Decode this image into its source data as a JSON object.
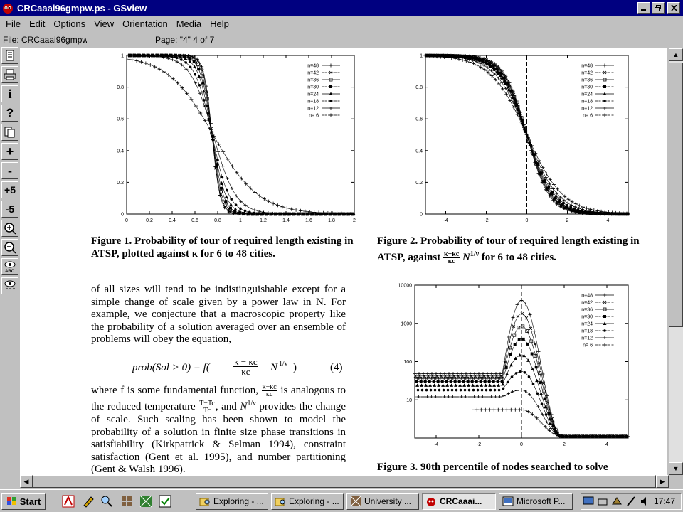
{
  "window": {
    "title": "CRCaaai96gmpw.ps - GSview"
  },
  "menu": [
    "File",
    "Edit",
    "Options",
    "View",
    "Orientation",
    "Media",
    "Help"
  ],
  "infobar": {
    "file": "File: CRCaaai96gmpw.ps",
    "page": "Page: \"4\"  4 of 7"
  },
  "toolbar": {
    "tools": [
      "open-icon",
      "print-icon",
      "info-icon",
      "help-icon",
      "goto-icon",
      "+",
      "-",
      "+5",
      "-5",
      "zoom-in-icon",
      "zoom-out-icon",
      "eye-abc-icon",
      "eye-icon"
    ]
  },
  "document": {
    "fig1_caption": "Figure 1.  Probability of tour of required length existing in ATSP, plotted against κ for 6 to 48 cities.",
    "fig2_caption_a": "Figure 2.  Probability of tour of required length existing in ATSP, against",
    "fig2_caption_b": "N",
    "fig2_caption_c": "for 6 to 48 cities.",
    "fig2_frac_num": "κ−κc",
    "fig2_frac_den": "κc",
    "fig2_exp": "1/ν",
    "fig3_caption": "Figure 3.  90th percentile of nodes searched to solve",
    "body_p1": "of all sizes will tend to be indistinguishable except for a simple change of scale given by a power law in N. For example, we conjecture that a macroscopic property like the probability of a solution averaged over an ensemble of problems will obey the equation,",
    "equation_lhs": "prob(Sol > 0) = f(",
    "equation_num": "κ − κc",
    "equation_den": "κc",
    "equation_rhs": "N",
    "equation_exp": "1/ν",
    "equation_close": ")",
    "equation_number": "(4)",
    "body_p2_a": "where f is some fundamental function,",
    "body_p2_frac_num": "κ−κc",
    "body_p2_frac_den": "κc",
    "body_p2_b": "is analogous to the reduced temperature",
    "body_p2_frac2_num": "T−Tc",
    "body_p2_frac2_den": "Tc",
    "body_p2_c": ", and",
    "body_p2_d": "N",
    "body_p2_exp": "1/ν",
    "body_p2_e": "provides the change of scale. Such scaling has been shown to model the probability of a solution in finite size phase transitions in satisfiability (Kirkpatrick & Selman 1994), constraint satisfaction (Gent et al. 1995), and number partitioning (Gent & Walsh 1996)."
  },
  "legend_labels": [
    "n=48",
    "n=42",
    "n=36",
    "n=30",
    "n=24",
    "n=18",
    "n=12",
    "n= 6"
  ],
  "chart_data": [
    {
      "type": "line",
      "title": "",
      "xlabel": "",
      "ylabel": "",
      "xlim": [
        0,
        2
      ],
      "ylim": [
        0,
        1
      ],
      "x_ticks": [
        "0",
        "0.2",
        "0.4",
        "0.6",
        "0.8",
        "1",
        "1.2",
        "1.4",
        "1.6",
        "1.8",
        "2"
      ],
      "y_ticks": [
        "0",
        "0.2",
        "0.4",
        "0.6",
        "0.8",
        "1"
      ],
      "legend_position": "top-right",
      "series": [
        {
          "name": "n=48",
          "kc": 0.75,
          "w": 0.035
        },
        {
          "name": "n=42",
          "kc": 0.75,
          "w": 0.038
        },
        {
          "name": "n=36",
          "kc": 0.75,
          "w": 0.043
        },
        {
          "name": "n=30",
          "kc": 0.75,
          "w": 0.05
        },
        {
          "name": "n=24",
          "kc": 0.75,
          "w": 0.06
        },
        {
          "name": "n=18",
          "kc": 0.75,
          "w": 0.075
        },
        {
          "name": "n=12",
          "kc": 0.76,
          "w": 0.1
        },
        {
          "name": "n= 6",
          "kc": 0.76,
          "w": 0.2
        }
      ]
    },
    {
      "type": "line",
      "title": "",
      "xlabel": "",
      "ylabel": "",
      "xlim": [
        -5,
        5
      ],
      "ylim": [
        0,
        1
      ],
      "x_ticks": [
        "-4",
        "-2",
        "0",
        "2",
        "4"
      ],
      "y_ticks": [
        "0",
        "0.2",
        "0.4",
        "0.6",
        "0.8",
        "1"
      ],
      "legend_position": "top-right",
      "series": [
        {
          "name": "n=48",
          "w": 0.55
        },
        {
          "name": "n=42",
          "w": 0.58
        },
        {
          "name": "n=36",
          "w": 0.6
        },
        {
          "name": "n=30",
          "w": 0.63
        },
        {
          "name": "n=24",
          "w": 0.66
        },
        {
          "name": "n=18",
          "w": 0.7
        },
        {
          "name": "n=12",
          "w": 0.78
        },
        {
          "name": "n= 6",
          "w": 0.9
        }
      ]
    },
    {
      "type": "line",
      "title": "",
      "xlabel": "",
      "ylabel": "",
      "xlim": [
        -5,
        5
      ],
      "ylim": [
        1,
        10000
      ],
      "y_scale": "log",
      "x_ticks": [
        "-4",
        "-2",
        "0",
        "2",
        "4"
      ],
      "y_ticks": [
        "10",
        "100",
        "1000",
        "10000"
      ],
      "legend_position": "top-right",
      "series": [
        {
          "name": "n=48",
          "base": 48,
          "peak": 4000
        },
        {
          "name": "n=42",
          "base": 42,
          "peak": 1800
        },
        {
          "name": "n=36",
          "base": 36,
          "peak": 850
        },
        {
          "name": "n=30",
          "base": 30,
          "peak": 400
        },
        {
          "name": "n=24",
          "base": 24,
          "peak": 150
        },
        {
          "name": "n=18",
          "base": 18,
          "peak": 55
        },
        {
          "name": "n=12",
          "base": 12,
          "peak": 18
        },
        {
          "name": "n= 6",
          "base": 5.5,
          "peak": 5.5
        }
      ]
    }
  ],
  "taskbar": {
    "start": "Start",
    "tasks": [
      "Exploring - ...",
      "Exploring - ...",
      "University ...",
      "CRCaaai...",
      "Microsoft P..."
    ],
    "clock": "17:47"
  }
}
